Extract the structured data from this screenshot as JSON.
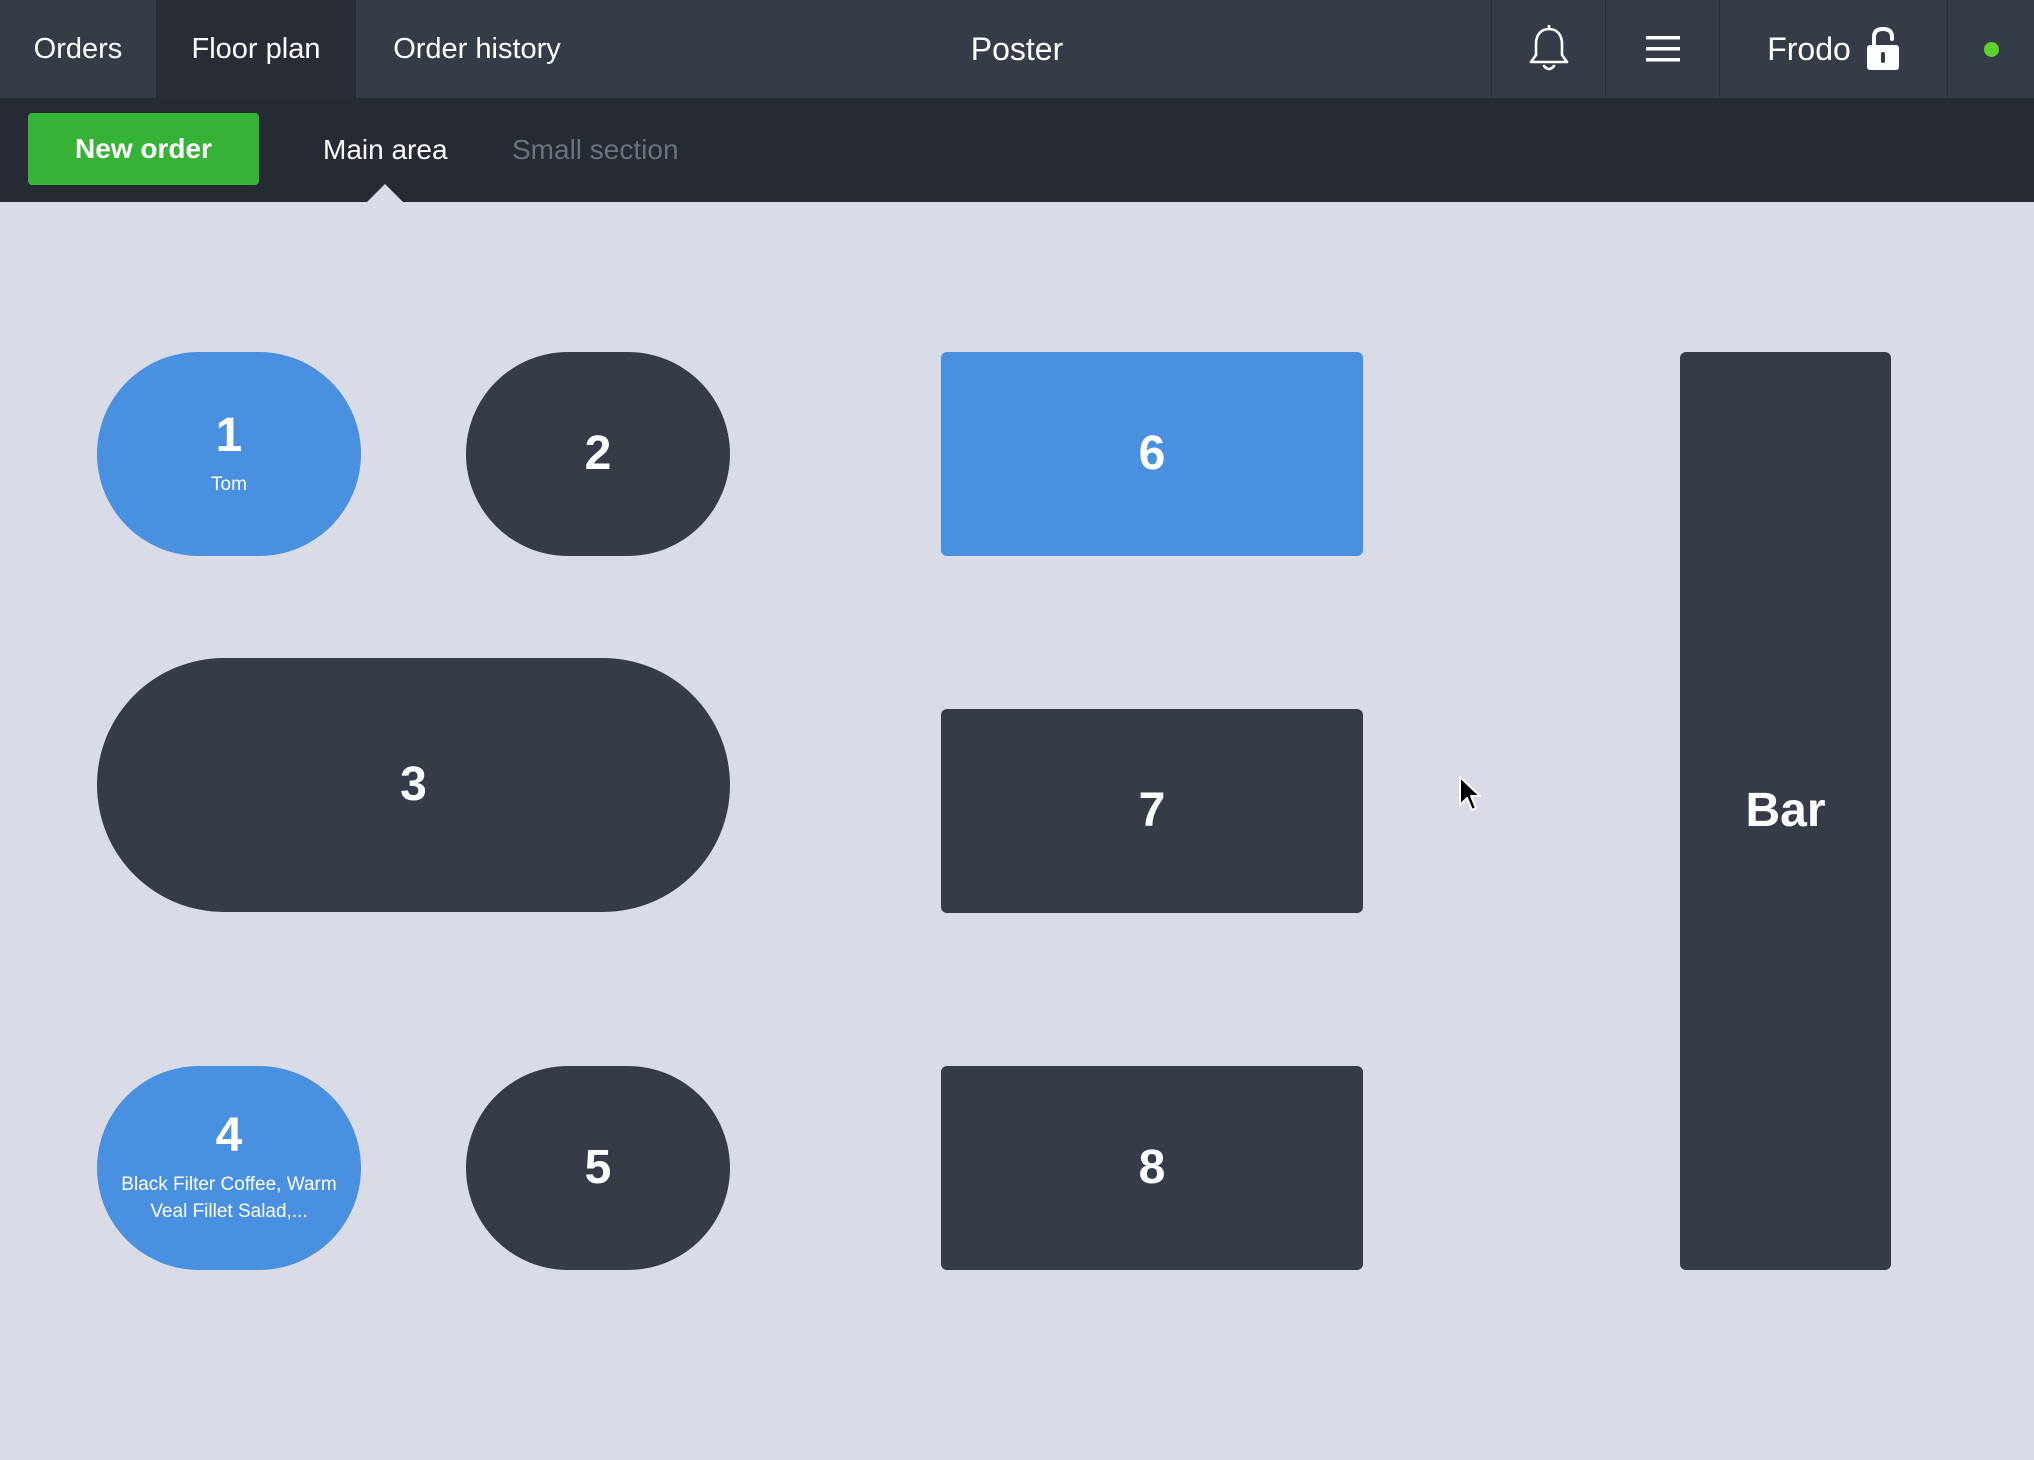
{
  "header": {
    "tabs": [
      {
        "label": "Orders"
      },
      {
        "label": "Floor plan"
      },
      {
        "label": "Order history"
      }
    ],
    "title": "Poster",
    "user": {
      "name": "Frodo"
    },
    "icons": {
      "notifications": "bell-icon",
      "menu": "hamburger-menu-icon",
      "lock": "unlocked-padlock-icon"
    },
    "status_color": "#5dd12c"
  },
  "subbar": {
    "new_order_label": "New order",
    "new_order_color": "#36b336",
    "areas": [
      {
        "label": "Main area",
        "selected": true
      },
      {
        "label": "Small section",
        "selected": false
      }
    ]
  },
  "floor": {
    "tables": [
      {
        "number": "1",
        "subtitle": "Tom",
        "shape": "round",
        "state": "busy"
      },
      {
        "number": "2",
        "subtitle": "",
        "shape": "round",
        "state": "free"
      },
      {
        "number": "3",
        "subtitle": "",
        "shape": "round",
        "state": "free"
      },
      {
        "number": "4",
        "subtitle": "Black Filter Coffee, Warm Veal Fillet Salad,...",
        "shape": "round",
        "state": "busy"
      },
      {
        "number": "5",
        "subtitle": "",
        "shape": "round",
        "state": "free"
      },
      {
        "number": "6",
        "subtitle": "",
        "shape": "rect",
        "state": "busy"
      },
      {
        "number": "7",
        "subtitle": "",
        "shape": "rect",
        "state": "free"
      },
      {
        "number": "8",
        "subtitle": "",
        "shape": "rect",
        "state": "free"
      },
      {
        "number": "Bar",
        "subtitle": "",
        "shape": "rect",
        "state": "free"
      }
    ],
    "colors": {
      "busy": "#4a90e0",
      "free": "#363c47",
      "background": "#d9dbe7"
    }
  }
}
